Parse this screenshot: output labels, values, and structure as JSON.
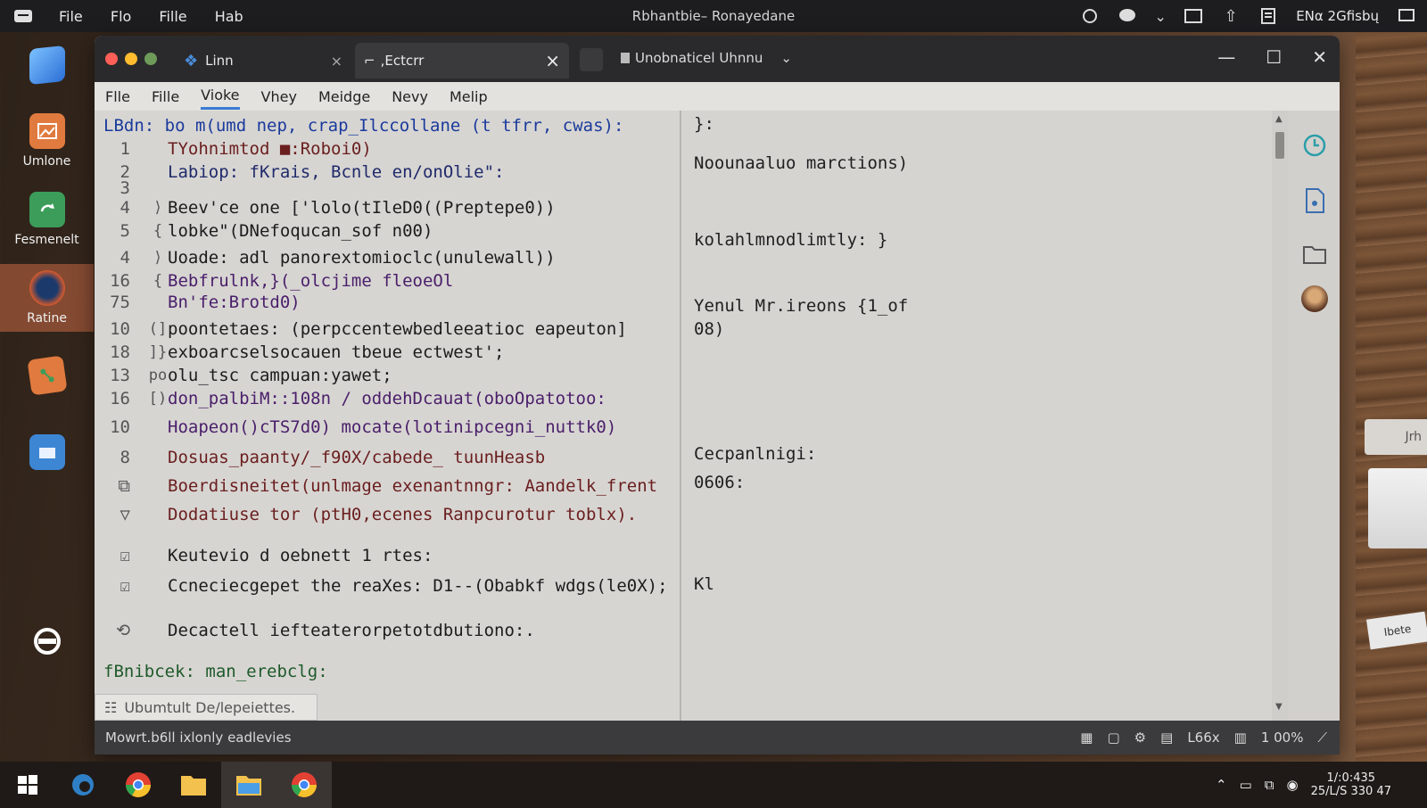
{
  "topbar": {
    "menu": [
      "File",
      "Flo",
      "Fille",
      "Hab"
    ],
    "title": "Rbhantbie– Ronayedane",
    "tray_text": "ENα 2Gfisbų"
  },
  "dock": [
    {
      "label": "Umlone",
      "icon": "image-icon",
      "color": "#e07a3e"
    },
    {
      "label": "Fesmenelt",
      "icon": "recycle-icon",
      "color": "#3c9d5a"
    },
    {
      "label": "Ratine",
      "icon": "browser-icon",
      "color": "#3a6fb0"
    },
    {
      "label": "",
      "icon": "git-icon",
      "color": "#e07a3e"
    },
    {
      "label": "",
      "icon": "folder-icon",
      "color": "#3d86d4"
    },
    {
      "label": "",
      "icon": "ubuntu-icon",
      "color": "#ffffff"
    }
  ],
  "window": {
    "tabs": [
      {
        "label": "Linn"
      },
      {
        "label": ",Ectcrr"
      }
    ],
    "tab3_label": "Unobnaticel Uhnnu",
    "menus": [
      "Flle",
      "Fille",
      "Vioke",
      "Vhey",
      "Meidge",
      "Nevy",
      "Melip"
    ],
    "active_menu": "Vioke"
  },
  "editor": {
    "lines": [
      {
        "no": "",
        "mark": "",
        "text": "LBdn: bo m(umd nep, crap_Ilccollane (t tfrr, cwas):",
        "color": "#1a3a9c"
      },
      {
        "no": "1",
        "mark": "",
        "text": "TYohnimtod ■:Roboi0)",
        "color": "#6a1e1e"
      },
      {
        "no": "2",
        "mark": "",
        "text": "Labiop: fKrais, Bcnle en/onOlie\":",
        "color": "#1f2a6a"
      },
      {
        "no": "3",
        "mark": "",
        "text": "",
        "color": "#1c1c1c"
      },
      {
        "no": "4",
        "mark": "⟩",
        "text": "Beev'ce one ['lolo(tIleD0((Preptepe0))",
        "color": "#1c1c1c"
      },
      {
        "no": "5",
        "mark": "{",
        "text": "lobke\"(DNefoqucan_sof n00)",
        "color": "#1c1c1c"
      },
      {
        "no": "4",
        "mark": "⟩",
        "text": "Uoade: adl panorextomioclc(unulewall))",
        "color": "#1c1c1c"
      },
      {
        "no": "16",
        "mark": "{",
        "text": "Bebfrulnk,}(_olcjime fleoeOl",
        "color": "#4a1e6a"
      },
      {
        "no": "75",
        "mark": "",
        "text": "Bn'fe:Brotd0)",
        "color": "#4a1e6a"
      },
      {
        "no": "10",
        "mark": "(]",
        "text": "poontetaes: (perpccentewbedleeatioc eapeuton]",
        "color": "#1c1c1c"
      },
      {
        "no": "18",
        "mark": "]}",
        "text": "exboarcselsocauen tbeue ectwest';",
        "color": "#1c1c1c"
      },
      {
        "no": "13",
        "mark": "po",
        "text": "olu_tsc campuan:yawet;",
        "color": "#1c1c1c"
      },
      {
        "no": "16",
        "mark": "[)",
        "text": "don_palbiM::108n / oddehDcauat(oboOpatotoo:",
        "color": "#4a1e6a"
      },
      {
        "no": "10",
        "mark": "",
        "text": "Hoapeon()cTS7d0) mocate(lotinipcegni_nuttk0)",
        "color": "#4a1e6a"
      },
      {
        "no": "8",
        "mark": "",
        "text": "Dosuas_paanty/_f90X/cabede_ tuunHeasb",
        "color": "#6a1e1e"
      },
      {
        "no": "⧉",
        "mark": "",
        "text": "Boerdisneitet(unlmage exenantnngr: Aandelk_frent",
        "color": "#6a1e1e"
      },
      {
        "no": "▽",
        "mark": "",
        "text": "Dodatiuse tor (ptH0,ecenes Ranpcurotur toblx).",
        "color": "#6a1e1e"
      },
      {
        "no": "☑",
        "mark": "",
        "text": "Keutevio d oebnett 1 rtes:",
        "color": "#1c1c1c"
      },
      {
        "no": "☑",
        "mark": "",
        "text": "Ccneciecgepet the reaXes: D1--(Obabkf wdgs(le0X);",
        "color": "#1c1c1c"
      },
      {
        "no": "⟲",
        "mark": "",
        "text": "Decactell iefteaterorpetotdbutiono:.",
        "color": "#1c1c1c"
      },
      {
        "no": "",
        "mark": "",
        "text": "fBnibcek: man_erebclg:",
        "color": "#1f5a2a"
      }
    ]
  },
  "output": [
    {
      "text": "}:"
    },
    {
      "text": "Noounaaluo marctions)"
    },
    {
      "text": "kolahlmnodlimtly: }"
    },
    {
      "text": "Yenul Mr.ireons {1_of"
    },
    {
      "text": "08)"
    },
    {
      "text": "Cecpanlnigi:"
    },
    {
      "text": "0606:"
    },
    {
      "text": "Kl"
    }
  ],
  "bottom_tab": "Ubumtult De/lepeiettes.",
  "status": {
    "left": "Mowrt.b6ll ixlonly eadlevies",
    "zoom": "L66x",
    "percent": "1 00%"
  },
  "wood_label": "Jrh",
  "wood_card": "Ibete",
  "clock": {
    "time": "1/:0:435",
    "date": "25/L/S 330 47"
  },
  "colors": {
    "accent": "#3a7bd5",
    "editor_bg": "#d7d5d2",
    "titlebar": "#2a2a2c"
  }
}
